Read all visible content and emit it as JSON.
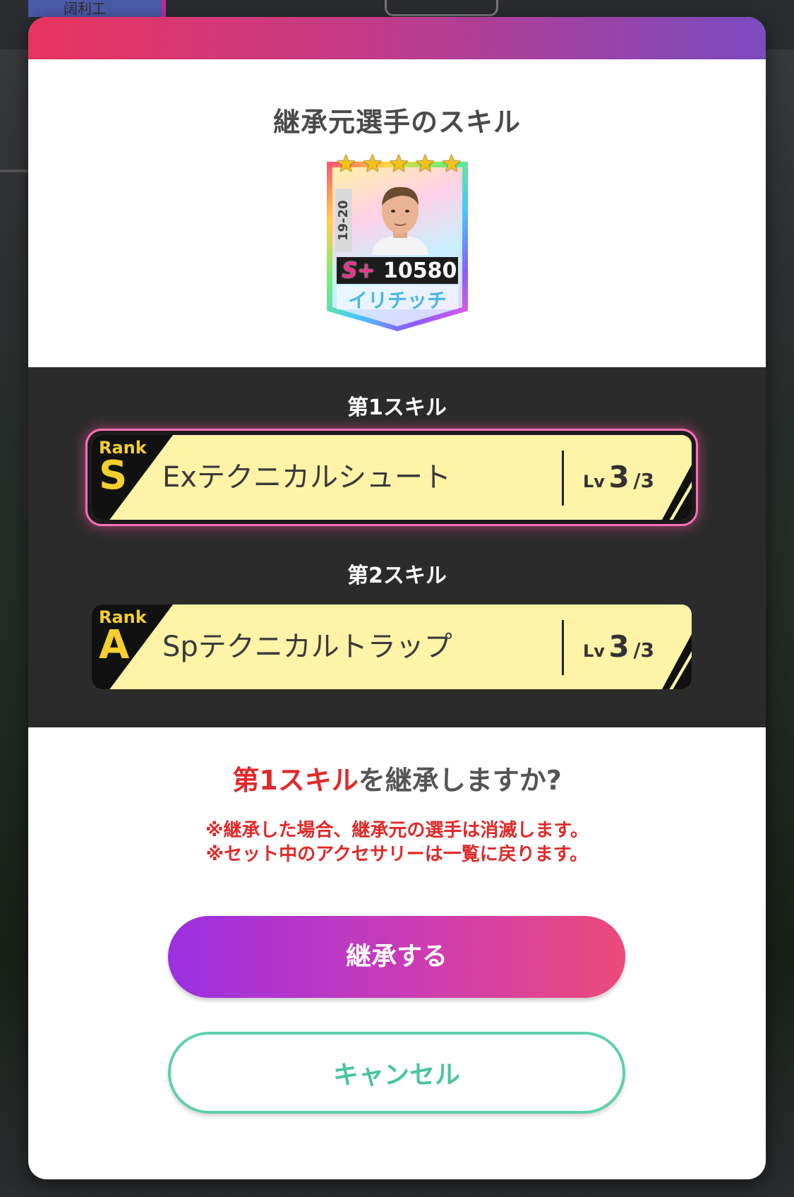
{
  "background": {
    "tab_label": "阔利工"
  },
  "modal": {
    "title": "継承元選手のスキル",
    "player": {
      "season": "19-20",
      "rank": "S+",
      "score": "10580",
      "name": "イリチッチ",
      "stars": 5
    },
    "skills": [
      {
        "heading": "第1スキル",
        "rank_label": "Rank",
        "rank": "S",
        "name": "Exテクニカルシュート",
        "lv_label": "Lv",
        "level": "3",
        "max": "/3",
        "selected": true
      },
      {
        "heading": "第2スキル",
        "rank_label": "Rank",
        "rank": "A",
        "name": "Spテクニカルトラップ",
        "lv_label": "Lv",
        "level": "3",
        "max": "/3",
        "selected": false
      }
    ],
    "question": {
      "highlight": "第1スキル",
      "rest": "を継承しますか?"
    },
    "notes": [
      "※継承した場合、継承元の選手は消滅します。",
      "※セット中のアクセサリーは一覧に戻ります。"
    ],
    "confirm_label": "継承する",
    "cancel_label": "キャンセル"
  },
  "colors": {
    "accent_pink": "#e8345f",
    "accent_purple": "#9b2fe0",
    "warning_red": "#e02a2a",
    "cancel_green": "#49c69a",
    "skill_bar": "#fff3a8"
  }
}
